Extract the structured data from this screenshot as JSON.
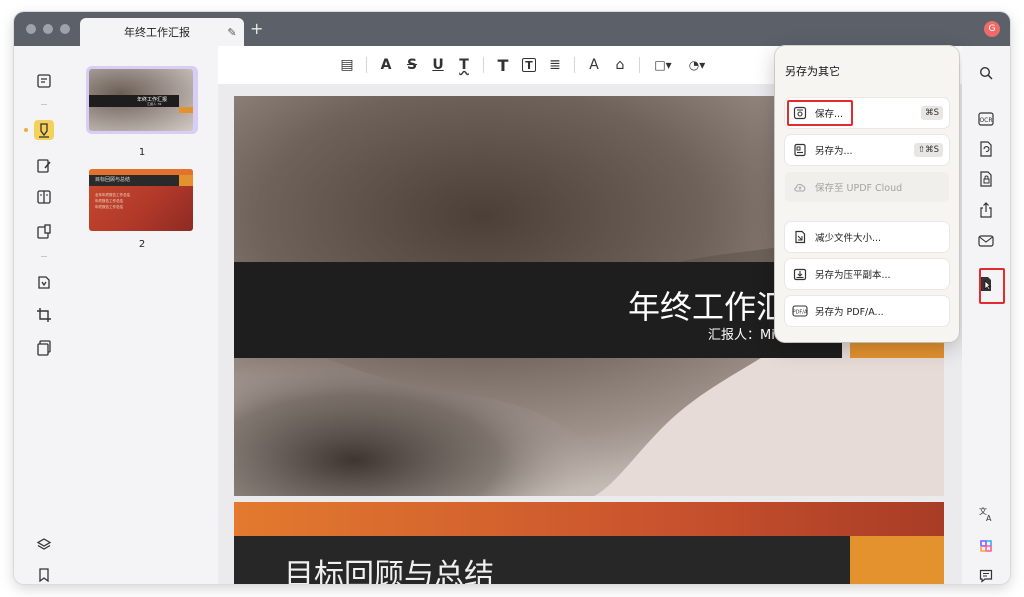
{
  "window": {
    "tab_title": "年终工作汇报",
    "tab_edit_icon": "✎",
    "tab_add_icon": "+",
    "avatar_letter": "G"
  },
  "toolbar": {
    "tools": [
      {
        "name": "comment-icon",
        "glyph": "▤"
      },
      {
        "name": "highlighter-icon",
        "glyph": "A"
      },
      {
        "name": "strikethrough-icon",
        "glyph": "S"
      },
      {
        "name": "underline-icon",
        "glyph": "U"
      },
      {
        "name": "squiggly-icon",
        "glyph": "T"
      },
      {
        "name": "text-icon",
        "glyph": "T"
      },
      {
        "name": "textbox-icon",
        "glyph": "T"
      },
      {
        "name": "text-callout-icon",
        "glyph": "≣"
      },
      {
        "name": "pencil-icon",
        "glyph": "A"
      },
      {
        "name": "eraser-icon",
        "glyph": "⌂"
      },
      {
        "name": "shape-icon",
        "glyph": "□▾"
      },
      {
        "name": "stamp-icon",
        "glyph": "◔▾"
      }
    ]
  },
  "thumbnails": [
    {
      "label": "1",
      "title": "年终工作汇报",
      "subtitle": "汇报人: Mi"
    },
    {
      "label": "2",
      "title": "目标回顾与总结",
      "lines": [
        "全年年终报告工作总结",
        "年终报告工作总结",
        "年终报告工作总结"
      ]
    }
  ],
  "pages": {
    "page1_title": "年终工作汇",
    "page1_reporter": "汇报人：Mi",
    "page2_title": "目标回顾与总结"
  },
  "popup": {
    "title": "另存为其它",
    "items": [
      {
        "label": "保存...",
        "shortcut": "⌘S"
      },
      {
        "label": "另存为...",
        "shortcut": "⇧⌘S"
      },
      {
        "label": "保存至 UPDF Cloud",
        "shortcut": ""
      },
      {
        "label": "减少文件大小...",
        "shortcut": ""
      },
      {
        "label": "另存为压平副本...",
        "shortcut": ""
      },
      {
        "label": "另存为 PDF/A...",
        "shortcut": ""
      }
    ]
  },
  "colors": {
    "accent_orange": "#e3922e",
    "highlight_red": "#e42a2a",
    "selected_thumb": "#d7cdf5",
    "active_tool": "#f4d15b"
  }
}
